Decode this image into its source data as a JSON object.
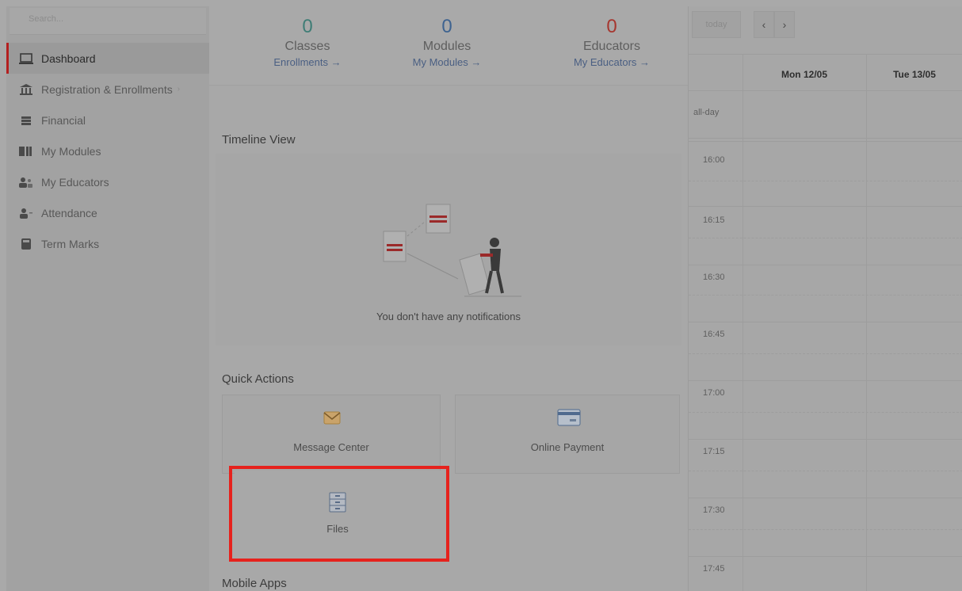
{
  "sidebar": {
    "search_placeholder": "Search...",
    "items": [
      {
        "label": "Dashboard",
        "icon": "laptop-icon"
      },
      {
        "label": "Registration & Enrollments",
        "icon": "institution-icon"
      },
      {
        "label": "Financial",
        "icon": "money-icon"
      },
      {
        "label": "My Modules",
        "icon": "book-icon"
      },
      {
        "label": "My Educators",
        "icon": "users-icon"
      },
      {
        "label": "Attendance",
        "icon": "user-check-icon"
      },
      {
        "label": "Term Marks",
        "icon": "calculator-icon"
      }
    ]
  },
  "stats": [
    {
      "value": "0",
      "label": "Classes",
      "link": "Enrollments",
      "color": "#3f7d76"
    },
    {
      "value": "0",
      "label": "Modules",
      "link": "My Modules",
      "color": "#3e6390"
    },
    {
      "value": "0",
      "label": "Educators",
      "link": "My Educators",
      "color": "#a6362f"
    }
  ],
  "stat_arrow": "→",
  "timeline": {
    "title": "Timeline View",
    "empty_message": "You don't have any notifications"
  },
  "quick_actions": {
    "title": "Quick Actions",
    "items": [
      {
        "label": "Message Center",
        "icon": "envelope-icon"
      },
      {
        "label": "Online Payment",
        "icon": "credit-card-icon"
      },
      {
        "label": "Files",
        "icon": "file-cabinet-icon"
      }
    ]
  },
  "mobile_apps": {
    "title": "Mobile Apps"
  },
  "calendar": {
    "today_label": "today",
    "prev": "‹",
    "next": "›",
    "days": [
      "Mon 12/05",
      "Tue 13/05"
    ],
    "all_day_label": "all-day",
    "times": [
      "16:00",
      "16:15",
      "16:30",
      "16:45",
      "17:00",
      "17:15",
      "17:30",
      "17:45"
    ]
  },
  "colors": {
    "accent": "#b41f1f",
    "highlight": "#e6221d"
  }
}
